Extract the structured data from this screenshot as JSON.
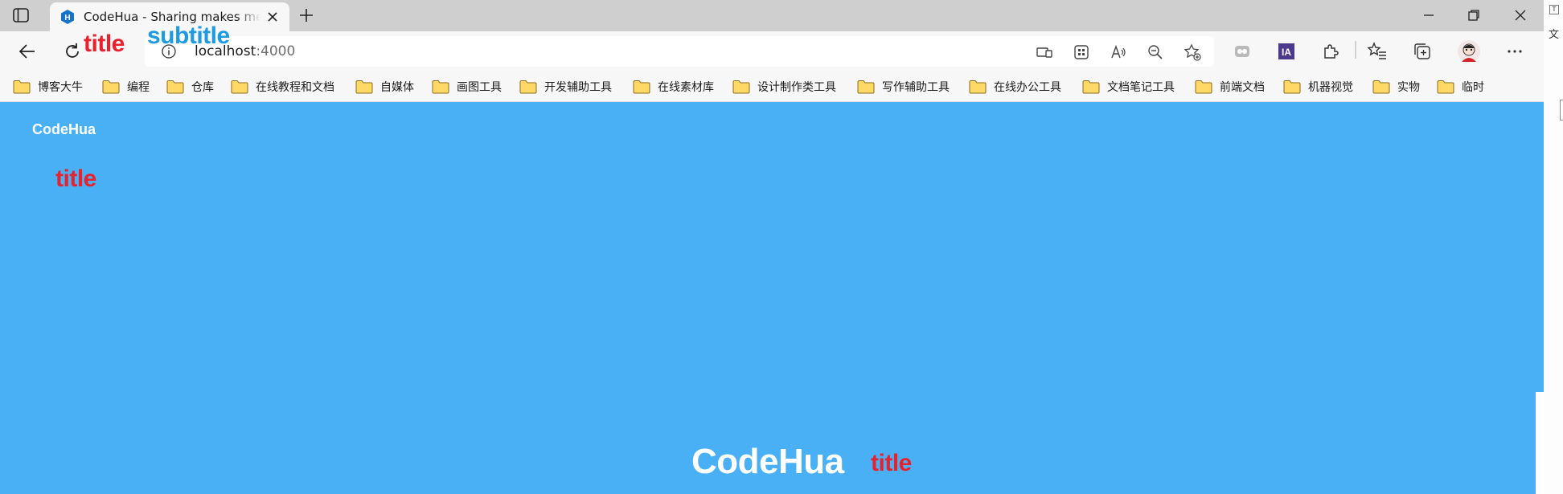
{
  "browser": {
    "tab": {
      "title": "CodeHua - Sharing makes me happy"
    },
    "url": {
      "host": "localhost",
      "port": ":4000"
    }
  },
  "overlay": {
    "title": "title",
    "subtitle": "subtitle"
  },
  "bookmarks": [
    {
      "label": "博客大牛"
    },
    {
      "label": "编程"
    },
    {
      "label": "仓库"
    },
    {
      "label": "在线教程和文档"
    },
    {
      "label": "自媒体"
    },
    {
      "label": "画图工具"
    },
    {
      "label": "开发辅助工具"
    },
    {
      "label": "在线素材库"
    },
    {
      "label": "设计制作类工具"
    },
    {
      "label": "写作辅助工具"
    },
    {
      "label": "在线办公工具"
    },
    {
      "label": "文档笔记工具"
    },
    {
      "label": "前端文档"
    },
    {
      "label": "机器视觉"
    },
    {
      "label": "实物"
    },
    {
      "label": "临时"
    }
  ],
  "side": {
    "tiny": "T",
    "char": "文"
  },
  "page": {
    "brand": "CodeHua",
    "title": "title",
    "hero": "CodeHua",
    "hero_title": "title"
  },
  "colors": {
    "page_bg": "#4ab0f5",
    "title_red": "#e8212f",
    "subtitle_blue": "#1e9be0",
    "brand_white": "#ffffff"
  }
}
